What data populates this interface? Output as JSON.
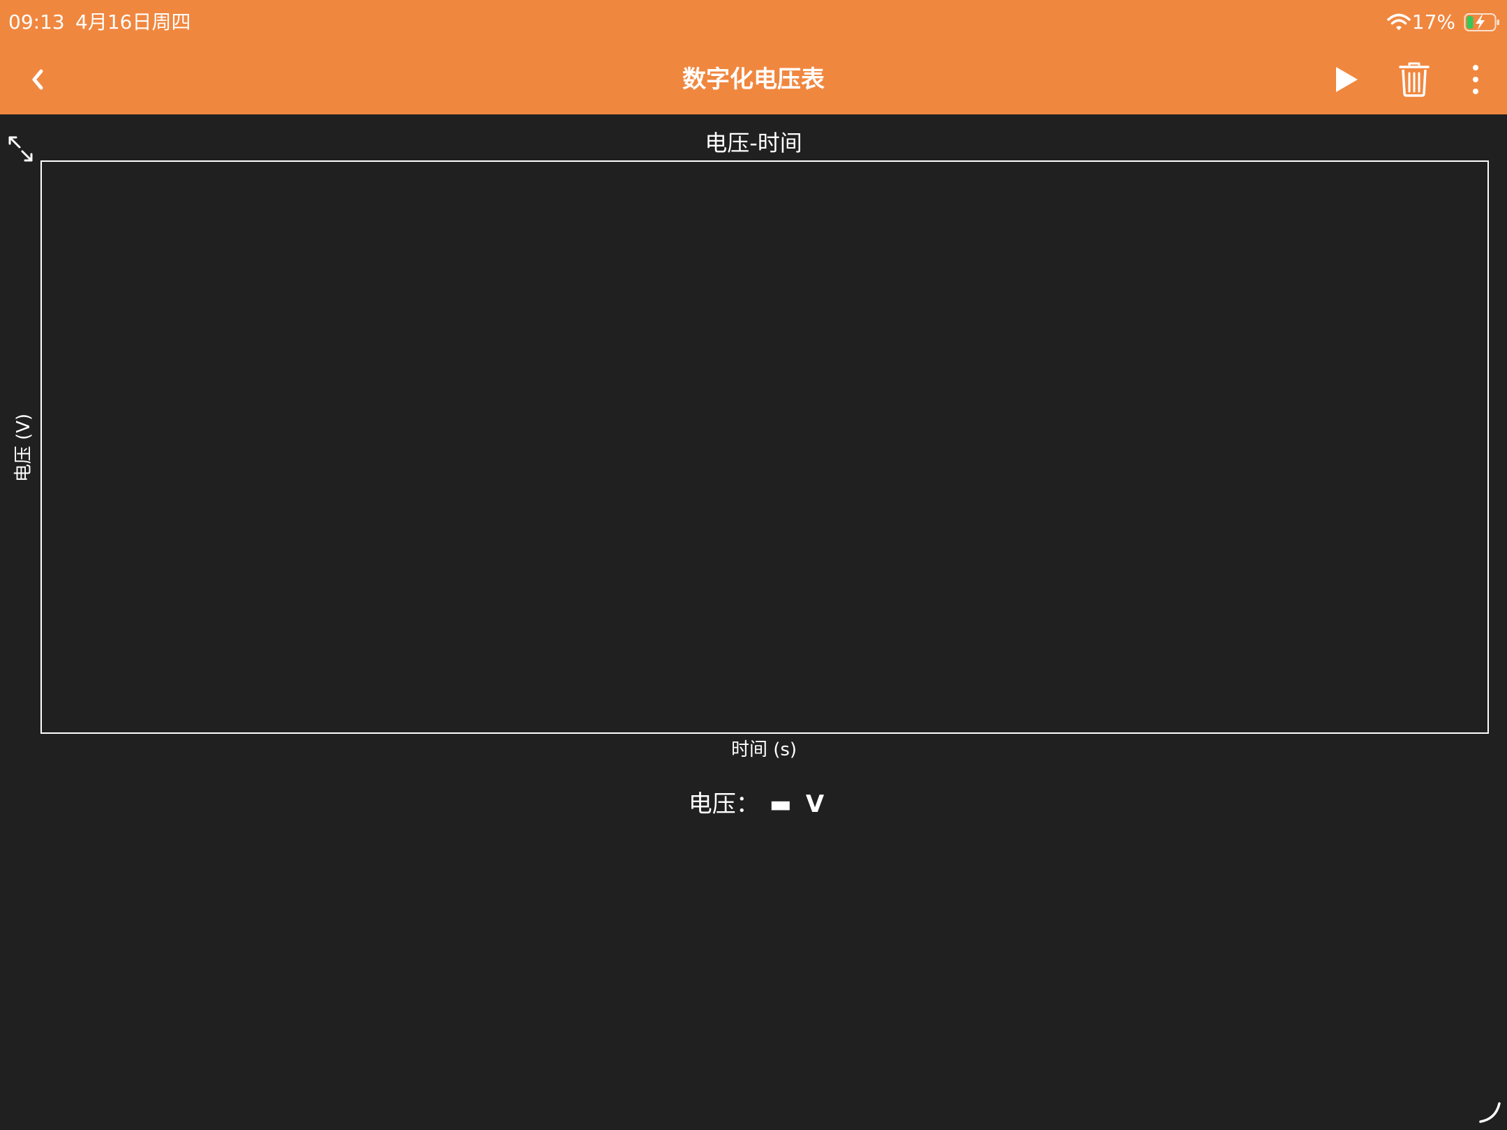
{
  "status_bar": {
    "time": "09:13",
    "date": "4月16日周四",
    "battery_percent": "17%",
    "wifi_icon": "wifi-icon",
    "battery_icon": "battery-charging-icon"
  },
  "nav": {
    "title": "数字化电压表",
    "back_icon": "chevron-left-icon",
    "play_icon": "play-icon",
    "trash_icon": "trash-icon",
    "more_icon": "more-vertical-icon"
  },
  "chart": {
    "expand_icon": "expand-icon",
    "title": "电压-时间",
    "ylabel": "电压 (V)",
    "xlabel": "时间 (s)"
  },
  "chart_data": {
    "type": "line",
    "title": "电压-时间",
    "xlabel": "时间 (s)",
    "ylabel": "电压 (V)",
    "series": [],
    "grid": false
  },
  "readout": {
    "label": "电压：",
    "value": "▬",
    "unit": "V"
  },
  "colors": {
    "accent": "#F0873F",
    "background": "#202020",
    "foreground": "#FFFFFF",
    "battery_fill": "#34C759"
  }
}
